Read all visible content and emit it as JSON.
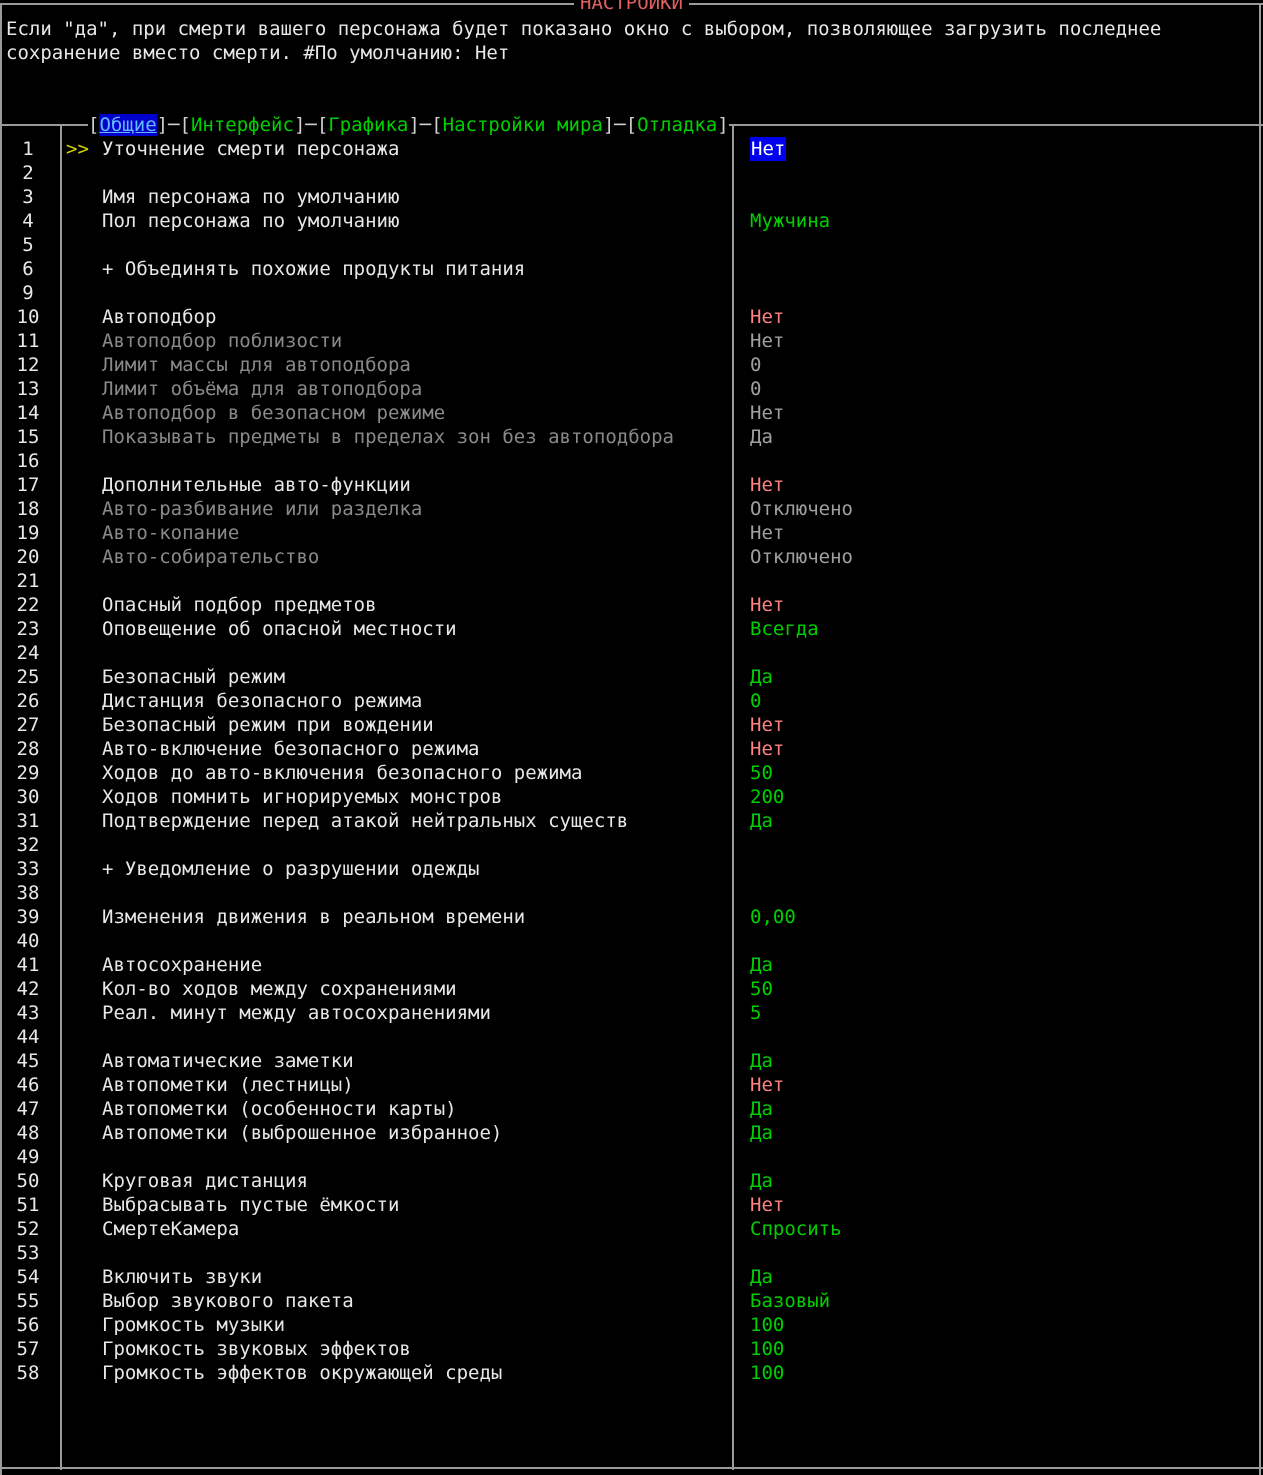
{
  "title": "НАСТРОЙКИ",
  "description": "Если \"да\", при смерти вашего персонажа будет показано окно с выбором, позволяющее загрузить последнее сохранение вместо смерти. #По умолчанию: Нет",
  "tabs": [
    {
      "label": "Общие"
    },
    {
      "label": "Интерфейс"
    },
    {
      "label": "Графика"
    },
    {
      "label": "Настройки мира"
    },
    {
      "label": "Отладка"
    }
  ],
  "active_tab": "Общие",
  "cursor": ">>",
  "colors": {
    "green": "#00d000",
    "red": "#ff8080",
    "grey": "#a0a0a0",
    "selection_bg": "#0000ee",
    "tab_green": "#00d000",
    "title_red": "#e06060"
  },
  "rows": [
    {
      "num": "1",
      "label": "Уточнение смерти персонажа",
      "value": "Нет",
      "style": "sel",
      "dim": false,
      "cursor": true
    },
    {
      "num": "2",
      "label": "",
      "value": "",
      "style": "",
      "dim": false,
      "cursor": false
    },
    {
      "num": "3",
      "label": "Имя персонажа по умолчанию",
      "value": "",
      "style": "",
      "dim": false,
      "cursor": false
    },
    {
      "num": "4",
      "label": "Пол персонажа по умолчанию",
      "value": "Мужчина",
      "style": "green",
      "dim": false,
      "cursor": false
    },
    {
      "num": "5",
      "label": "",
      "value": "",
      "style": "",
      "dim": false,
      "cursor": false
    },
    {
      "num": "6",
      "label": "+ Объединять похожие продукты питания",
      "value": "",
      "style": "",
      "dim": false,
      "cursor": false
    },
    {
      "num": "9",
      "label": "",
      "value": "",
      "style": "",
      "dim": false,
      "cursor": false
    },
    {
      "num": "10",
      "label": "Автоподбор",
      "value": "Нет",
      "style": "red",
      "dim": false,
      "cursor": false
    },
    {
      "num": "11",
      "label": "Автоподбор поблизости",
      "value": "Нет",
      "style": "grey",
      "dim": true,
      "cursor": false
    },
    {
      "num": "12",
      "label": "Лимит массы для автоподбора",
      "value": "0",
      "style": "grey",
      "dim": true,
      "cursor": false
    },
    {
      "num": "13",
      "label": "Лимит объёма для автоподбора",
      "value": "0",
      "style": "grey",
      "dim": true,
      "cursor": false
    },
    {
      "num": "14",
      "label": "Автоподбор в безопасном режиме",
      "value": "Нет",
      "style": "grey",
      "dim": true,
      "cursor": false
    },
    {
      "num": "15",
      "label": "Показывать предметы в пределах зон без автоподбора",
      "value": "Да",
      "style": "grey",
      "dim": true,
      "cursor": false
    },
    {
      "num": "16",
      "label": "",
      "value": "",
      "style": "",
      "dim": false,
      "cursor": false
    },
    {
      "num": "17",
      "label": "Дополнительные авто-функции",
      "value": "Нет",
      "style": "red",
      "dim": false,
      "cursor": false
    },
    {
      "num": "18",
      "label": "Авто-разбивание или разделка",
      "value": "Отключено",
      "style": "grey",
      "dim": true,
      "cursor": false
    },
    {
      "num": "19",
      "label": "Авто-копание",
      "value": "Нет",
      "style": "grey",
      "dim": true,
      "cursor": false
    },
    {
      "num": "20",
      "label": "Авто-собирательство",
      "value": "Отключено",
      "style": "grey",
      "dim": true,
      "cursor": false
    },
    {
      "num": "21",
      "label": "",
      "value": "",
      "style": "",
      "dim": false,
      "cursor": false
    },
    {
      "num": "22",
      "label": "Опасный подбор предметов",
      "value": "Нет",
      "style": "red",
      "dim": false,
      "cursor": false
    },
    {
      "num": "23",
      "label": "Оповещение об опасной местности",
      "value": "Всегда",
      "style": "green",
      "dim": false,
      "cursor": false
    },
    {
      "num": "24",
      "label": "",
      "value": "",
      "style": "",
      "dim": false,
      "cursor": false
    },
    {
      "num": "25",
      "label": "Безопасный режим",
      "value": "Да",
      "style": "green",
      "dim": false,
      "cursor": false
    },
    {
      "num": "26",
      "label": "Дистанция безопасного режима",
      "value": "0",
      "style": "green",
      "dim": false,
      "cursor": false
    },
    {
      "num": "27",
      "label": "Безопасный режим при вождении",
      "value": "Нет",
      "style": "red",
      "dim": false,
      "cursor": false
    },
    {
      "num": "28",
      "label": "Авто-включение безопасного режима",
      "value": "Нет",
      "style": "red",
      "dim": false,
      "cursor": false
    },
    {
      "num": "29",
      "label": "Ходов до авто-включения безопасного режима",
      "value": "50",
      "style": "green",
      "dim": false,
      "cursor": false
    },
    {
      "num": "30",
      "label": "Ходов помнить игнорируемых монстров",
      "value": "200",
      "style": "green",
      "dim": false,
      "cursor": false
    },
    {
      "num": "31",
      "label": "Подтверждение перед атакой нейтральных существ",
      "value": "Да",
      "style": "green",
      "dim": false,
      "cursor": false
    },
    {
      "num": "32",
      "label": "",
      "value": "",
      "style": "",
      "dim": false,
      "cursor": false
    },
    {
      "num": "33",
      "label": "+ Уведомление о разрушении одежды",
      "value": "",
      "style": "",
      "dim": false,
      "cursor": false
    },
    {
      "num": "38",
      "label": "",
      "value": "",
      "style": "",
      "dim": false,
      "cursor": false
    },
    {
      "num": "39",
      "label": "Изменения движения в реальном времени",
      "value": "0,00",
      "style": "green",
      "dim": false,
      "cursor": false
    },
    {
      "num": "40",
      "label": "",
      "value": "",
      "style": "",
      "dim": false,
      "cursor": false
    },
    {
      "num": "41",
      "label": "Автосохранение",
      "value": "Да",
      "style": "green",
      "dim": false,
      "cursor": false
    },
    {
      "num": "42",
      "label": "Кол-во ходов между сохранениями",
      "value": "50",
      "style": "green",
      "dim": false,
      "cursor": false
    },
    {
      "num": "43",
      "label": "Реал. минут между автосохранениями",
      "value": "5",
      "style": "green",
      "dim": false,
      "cursor": false
    },
    {
      "num": "44",
      "label": "",
      "value": "",
      "style": "",
      "dim": false,
      "cursor": false
    },
    {
      "num": "45",
      "label": "Автоматические заметки",
      "value": "Да",
      "style": "green",
      "dim": false,
      "cursor": false
    },
    {
      "num": "46",
      "label": "Автопометки (лестницы)",
      "value": "Нет",
      "style": "red",
      "dim": false,
      "cursor": false
    },
    {
      "num": "47",
      "label": "Автопометки (особенности карты)",
      "value": "Да",
      "style": "green",
      "dim": false,
      "cursor": false
    },
    {
      "num": "48",
      "label": "Автопометки (выброшенное избранное)",
      "value": "Да",
      "style": "green",
      "dim": false,
      "cursor": false
    },
    {
      "num": "49",
      "label": "",
      "value": "",
      "style": "",
      "dim": false,
      "cursor": false
    },
    {
      "num": "50",
      "label": "Круговая дистанция",
      "value": "Да",
      "style": "green",
      "dim": false,
      "cursor": false
    },
    {
      "num": "51",
      "label": "Выбрасывать пустые ёмкости",
      "value": "Нет",
      "style": "red",
      "dim": false,
      "cursor": false
    },
    {
      "num": "52",
      "label": "СмертеКамера",
      "value": "Спросить",
      "style": "green",
      "dim": false,
      "cursor": false
    },
    {
      "num": "53",
      "label": "",
      "value": "",
      "style": "",
      "dim": false,
      "cursor": false
    },
    {
      "num": "54",
      "label": "Включить звуки",
      "value": "Да",
      "style": "green",
      "dim": false,
      "cursor": false
    },
    {
      "num": "55",
      "label": "Выбор звукового пакета",
      "value": "Базовый",
      "style": "green",
      "dim": false,
      "cursor": false
    },
    {
      "num": "56",
      "label": "Громкость музыки",
      "value": "100",
      "style": "green",
      "dim": false,
      "cursor": false
    },
    {
      "num": "57",
      "label": "Громкость звуковых эффектов",
      "value": "100",
      "style": "green",
      "dim": false,
      "cursor": false
    },
    {
      "num": "58",
      "label": "Громкость эффектов окружающей среды",
      "value": "100",
      "style": "green",
      "dim": false,
      "cursor": false
    }
  ]
}
